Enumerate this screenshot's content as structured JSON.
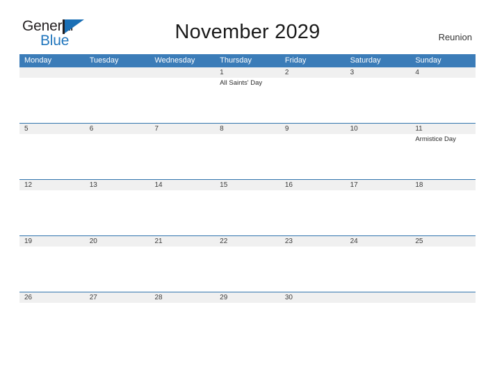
{
  "logo": {
    "word1": "General",
    "word2": "Blue",
    "triangle_color": "#1a6fb5",
    "text_color": "#231f20",
    "blue_color": "#2176bd"
  },
  "header": {
    "title": "November 2029",
    "region": "Reunion"
  },
  "theme": {
    "header_bar": "#3b7cb8",
    "date_band": "#f0f0f0",
    "rule": "#2f73ad",
    "background": "#ffffff"
  },
  "calendar": {
    "weekdays": [
      "Monday",
      "Tuesday",
      "Wednesday",
      "Thursday",
      "Friday",
      "Saturday",
      "Sunday"
    ],
    "month": "November",
    "year": "2029",
    "weeks": [
      {
        "days": [
          {
            "date": "",
            "event": ""
          },
          {
            "date": "",
            "event": ""
          },
          {
            "date": "",
            "event": ""
          },
          {
            "date": "1",
            "event": "All Saints' Day"
          },
          {
            "date": "2",
            "event": ""
          },
          {
            "date": "3",
            "event": ""
          },
          {
            "date": "4",
            "event": ""
          }
        ]
      },
      {
        "days": [
          {
            "date": "5",
            "event": ""
          },
          {
            "date": "6",
            "event": ""
          },
          {
            "date": "7",
            "event": ""
          },
          {
            "date": "8",
            "event": ""
          },
          {
            "date": "9",
            "event": ""
          },
          {
            "date": "10",
            "event": ""
          },
          {
            "date": "11",
            "event": "Armistice Day"
          }
        ]
      },
      {
        "days": [
          {
            "date": "12",
            "event": ""
          },
          {
            "date": "13",
            "event": ""
          },
          {
            "date": "14",
            "event": ""
          },
          {
            "date": "15",
            "event": ""
          },
          {
            "date": "16",
            "event": ""
          },
          {
            "date": "17",
            "event": ""
          },
          {
            "date": "18",
            "event": ""
          }
        ]
      },
      {
        "days": [
          {
            "date": "19",
            "event": ""
          },
          {
            "date": "20",
            "event": ""
          },
          {
            "date": "21",
            "event": ""
          },
          {
            "date": "22",
            "event": ""
          },
          {
            "date": "23",
            "event": ""
          },
          {
            "date": "24",
            "event": ""
          },
          {
            "date": "25",
            "event": ""
          }
        ]
      },
      {
        "days": [
          {
            "date": "26",
            "event": ""
          },
          {
            "date": "27",
            "event": ""
          },
          {
            "date": "28",
            "event": ""
          },
          {
            "date": "29",
            "event": ""
          },
          {
            "date": "30",
            "event": ""
          },
          {
            "date": "",
            "event": ""
          },
          {
            "date": "",
            "event": ""
          }
        ]
      }
    ]
  }
}
